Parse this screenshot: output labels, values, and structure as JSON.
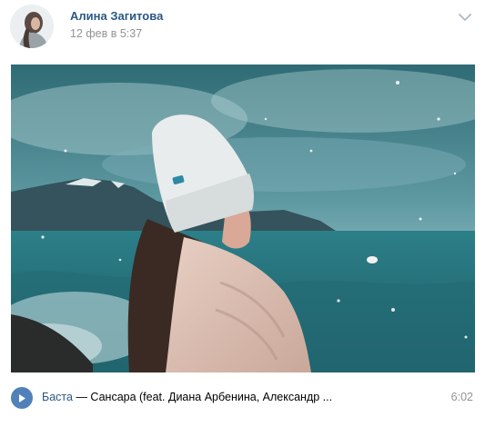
{
  "post": {
    "author": "Алина Загитова",
    "timestamp": "12 фев в 5:37"
  },
  "icons": {
    "menu": "chevron-down-icon",
    "play": "play-icon"
  },
  "audio": {
    "artist": "Баста",
    "separator": "—",
    "title": "Сансара (feat. Диана Арбенина, Александр ...",
    "duration": "6:02"
  },
  "colors": {
    "link": "#2a5885",
    "secondary_text": "#939393",
    "play_button": "#5181b8"
  }
}
